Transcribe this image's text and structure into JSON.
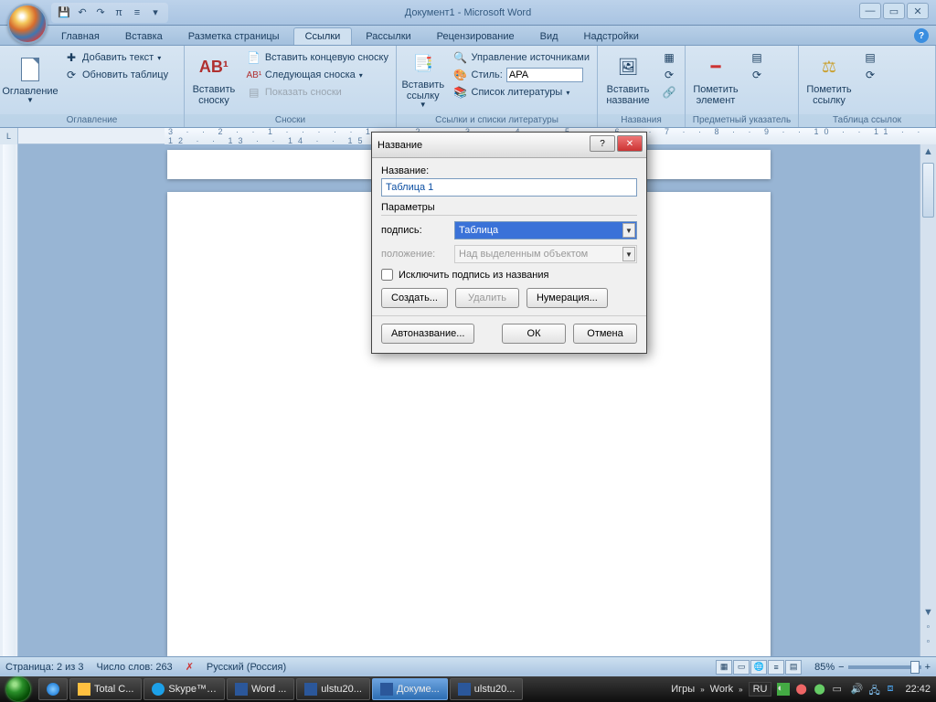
{
  "app_title": "Документ1 - Microsoft Word",
  "qat_items": [
    "save",
    "undo",
    "redo",
    "pi",
    "format"
  ],
  "ribbon": {
    "tabs": [
      "Главная",
      "Вставка",
      "Разметка страницы",
      "Ссылки",
      "Рассылки",
      "Рецензирование",
      "Вид",
      "Надстройки"
    ],
    "active_tab_index": 3,
    "groups": {
      "toc": {
        "big": "Оглавление",
        "add_text": "Добавить текст",
        "update_table": "Обновить таблицу",
        "label": "Оглавление"
      },
      "footnotes": {
        "big": "Вставить сноску",
        "insert_endnote": "Вставить концевую сноску",
        "next_footnote": "Следующая сноска",
        "show_notes": "Показать сноски",
        "label": "Сноски"
      },
      "citations": {
        "big": "Вставить ссылку",
        "manage_sources": "Управление источниками",
        "style_label": "Стиль:",
        "style_value": "APA",
        "bibliography": "Список литературы",
        "label": "Ссылки и списки литературы"
      },
      "captions": {
        "big": "Вставить название",
        "label": "Названия"
      },
      "index": {
        "big": "Пометить элемент",
        "label": "Предметный указатель"
      },
      "toa": {
        "big": "Пометить ссылку",
        "label": "Таблица ссылок"
      }
    }
  },
  "ruler_numbers": "3 · · 2 · · 1 · · · · · 1 · · 2 · · 3 · · 4 · · 5 · · 6 · · 7 · · 8 · · 9 · · 10 · · 11 · · 12 · · 13 · · 14 · · 15 · · 16 · △ 17 ·",
  "dialog": {
    "title": "Название",
    "name_label": "Название:",
    "name_value": "Таблица 1",
    "params_header": "Параметры",
    "row_label_caption": "подпись:",
    "caption_value": "Таблица",
    "row_label_position": "положение:",
    "position_value": "Над выделенным объектом",
    "exclude_label": "Исключить подпись из названия",
    "btn_new": "Создать...",
    "btn_delete": "Удалить",
    "btn_numbering": "Нумерация...",
    "btn_autocaption": "Автоназвание...",
    "btn_ok": "ОК",
    "btn_cancel": "Отмена"
  },
  "statusbar": {
    "page": "Страница: 2 из 3",
    "words": "Число слов: 263",
    "language": "Русский (Россия)",
    "zoom": "85%"
  },
  "taskbar": {
    "items": [
      {
        "label": "",
        "icon": "ie"
      },
      {
        "label": "Total C..."
      },
      {
        "label": "Skype™…"
      },
      {
        "label": "Word ..."
      },
      {
        "label": "ulstu20..."
      },
      {
        "label": "Докуме...",
        "active": true
      },
      {
        "label": "ulstu20..."
      }
    ],
    "toolbar_labels": [
      "Игры",
      "Work"
    ],
    "lang": "RU",
    "clock": "22:42"
  }
}
